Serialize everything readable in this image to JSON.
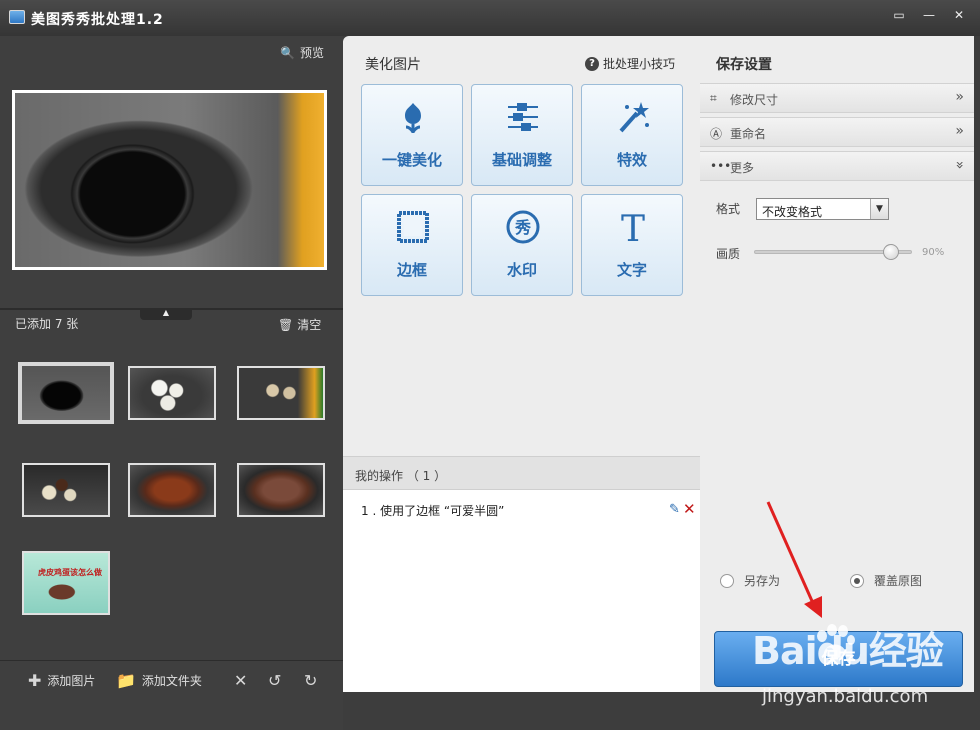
{
  "window": {
    "title": "美图秀秀批处理1.2",
    "controls": [
      "feedback-icon",
      "minimize-icon",
      "close-icon"
    ]
  },
  "left": {
    "preview_label": "预览",
    "added_count": "已添加 7 张",
    "clear_label": "清空",
    "thumbnails": [
      {
        "id": "pot-empty",
        "selected": true
      },
      {
        "id": "eggs-colander",
        "selected": false
      },
      {
        "id": "eggs-pot-oil",
        "selected": false
      },
      {
        "id": "eggs-sauce",
        "selected": false
      },
      {
        "id": "braised-eggs",
        "selected": false
      },
      {
        "id": "braised-pot",
        "selected": false
      },
      {
        "id": "recipe-card",
        "selected": false,
        "caption": "虎皮鸡蛋该怎么做"
      }
    ],
    "bottom": {
      "add_image": "添加图片",
      "add_folder": "添加文件夹"
    }
  },
  "middle": {
    "heading": "美化图片",
    "tips_label": "批处理小技巧",
    "tools": [
      {
        "label": "一键美化",
        "icon": "tulip-icon"
      },
      {
        "label": "基础调整",
        "icon": "sliders-icon"
      },
      {
        "label": "特效",
        "icon": "magic-wand-icon"
      },
      {
        "label": "边框",
        "icon": "frame-icon"
      },
      {
        "label": "水印",
        "icon": "watermark-icon"
      },
      {
        "label": "文字",
        "icon": "text-icon"
      }
    ],
    "ops_title": "我的操作 （ 1 ）",
    "ops": [
      {
        "text": "1 . 使用了边框 “可爱半圆”"
      }
    ]
  },
  "right": {
    "heading": "保存设置",
    "sections": [
      {
        "label": "修改尺寸",
        "icon": "crop-icon",
        "expanded": false
      },
      {
        "label": "重命名",
        "icon": "rename-icon",
        "expanded": false
      },
      {
        "label": "更多",
        "icon": "more-icon",
        "expanded": true
      }
    ],
    "format_label": "格式",
    "format_value": "不改变格式",
    "quality_label": "画质",
    "quality_value": 0.9,
    "quality_text": "90%",
    "save_as_label": "另存为",
    "overwrite_label": "覆盖原图",
    "overwrite_selected": true,
    "save_label": "保存"
  },
  "watermark": {
    "brand": "Baidu经验",
    "url": "jingyan.baidu.com"
  },
  "colors": {
    "accent": "#2a6cb0",
    "save_button": "#3d89d8",
    "arrow": "#e02020"
  }
}
